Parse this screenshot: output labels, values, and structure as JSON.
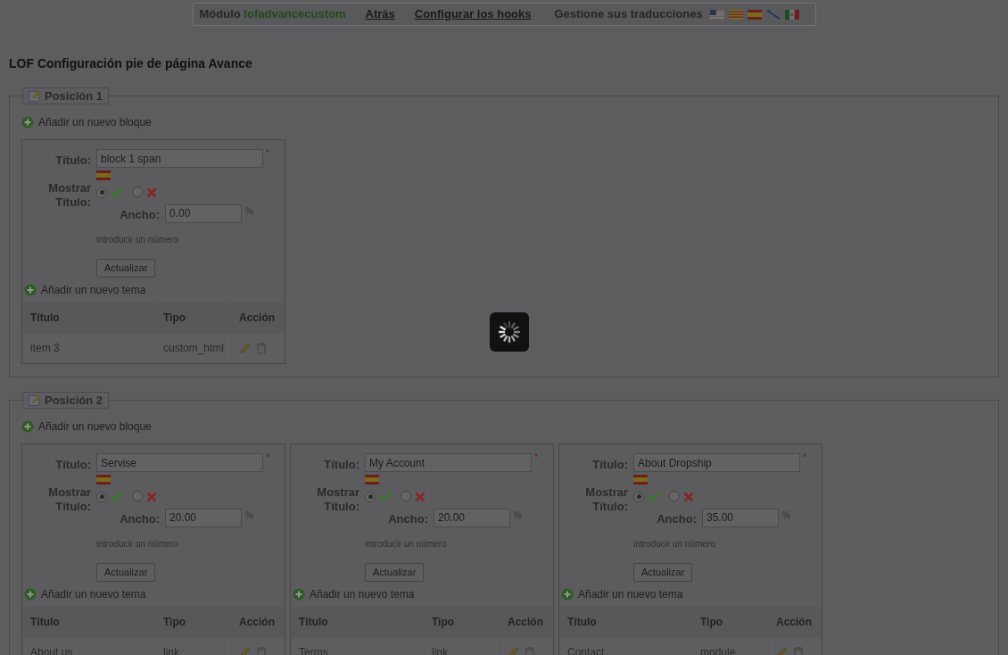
{
  "header": {
    "module_label": "Módulo",
    "module_name": "lofadvancecustom",
    "links": [
      "Atrás",
      "Configurar los hooks"
    ],
    "translations_label": "Gestione sus traducciones"
  },
  "page_title": "LOF Configuración pie de página Avance",
  "positions": [
    {
      "legend": "Posición 1",
      "add_block": "Añadir un nuevo bloque",
      "blocks": [
        {
          "title_label": "Título:",
          "title_value": "block 1 span",
          "required": "*",
          "show_title_label": "Mostrar Título:",
          "show_title": true,
          "width_label": "Ancho:",
          "width_value": "0.00",
          "unit": "%",
          "hint": "introducir un número",
          "update_button": "Actualizar",
          "add_item": "Añadir un nuevo tema",
          "columns": [
            "Título",
            "Tipo",
            "Acción"
          ],
          "rows": [
            {
              "title": "item 3",
              "type": "custom_html"
            }
          ]
        }
      ]
    },
    {
      "legend": "Posición 2",
      "add_block": "Añadir un nuevo bloque",
      "blocks": [
        {
          "title_label": "Título:",
          "title_value": "Servise",
          "required": "*",
          "show_title_label": "Mostrar Título:",
          "show_title": true,
          "width_label": "Ancho:",
          "width_value": "20.00",
          "unit": "%",
          "hint": "introducir un número",
          "update_button": "Actualizar",
          "add_item": "Añadir un nuevo tema",
          "columns": [
            "Título",
            "Tipo",
            "Acción"
          ],
          "rows": [
            {
              "title": "About us",
              "type": "link"
            }
          ]
        },
        {
          "title_label": "Título:",
          "title_value": "My Account",
          "required": "*",
          "show_title_label": "Mostrar Título:",
          "show_title": true,
          "width_label": "Ancho:",
          "width_value": "20.00",
          "unit": "%",
          "hint": "introducir un número",
          "update_button": "Actualizar",
          "add_item": "Añadir un nuevo tema",
          "columns": [
            "Título",
            "Tipo",
            "Acción"
          ],
          "rows": [
            {
              "title": "Terms",
              "type": "link"
            }
          ]
        },
        {
          "title_label": "Título:",
          "title_value": "About Dropship",
          "required": "*",
          "show_title_label": "Mostrar Título:",
          "show_title": true,
          "width_label": "Ancho:",
          "width_value": "35.00",
          "unit": "%",
          "hint": "introducir un número",
          "update_button": "Actualizar",
          "add_item": "Añadir un nuevo tema",
          "columns": [
            "Título",
            "Tipo",
            "Acción"
          ],
          "rows": [
            {
              "title": "Contact",
              "type": "module"
            }
          ]
        }
      ]
    }
  ]
}
